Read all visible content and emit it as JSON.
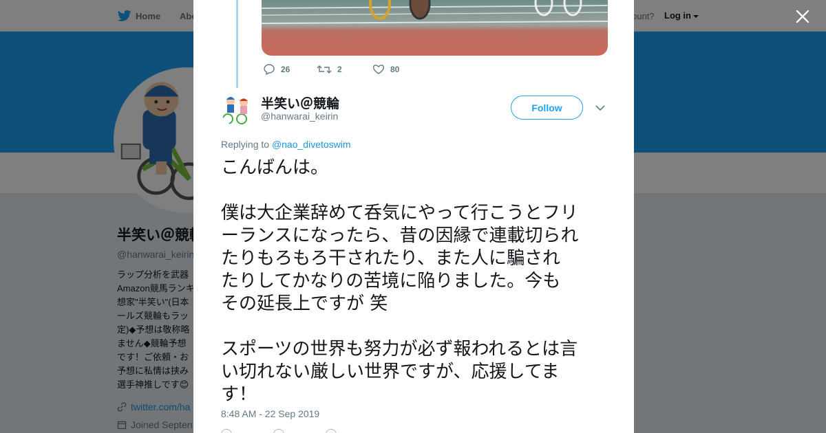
{
  "nav": {
    "home_label": "Home",
    "about_label": "Abo",
    "account_text": "ccount?",
    "login_label": "Log in"
  },
  "profile": {
    "name": "半笑い＠競輪",
    "handle": "@hanwarai_keirin",
    "bio": "ラップ分析を武器\nAmazon競馬ランキ\n想家\"半笑い\"(日本\nールズ競輪もラッ\n定)◆予想は敬称略\nません◆競輪予想\nです！ご依頼・お\n予想に私情は挟み\n選手神推しです😊",
    "link": "twitter.com/ha",
    "joined": "Joined Septen"
  },
  "quoted_tweet": {
    "replies": "26",
    "retweets": "2",
    "likes": "80"
  },
  "tweet": {
    "author_name": "半笑い＠競輪",
    "author_handle": "@hanwarai_keirin",
    "follow_label": "Follow",
    "replying_prefix": "Replying to",
    "replying_to": "@nao_divetoswim",
    "text_lines": [
      "こんばんは。",
      "",
      "僕は大企業辞めて呑気にやって行こうとフリ",
      "ーランスになったら、昔の因縁で連載切られ",
      "たりもろもろ干されたり、また人に騙され",
      "たりしてかなりの苦境に陥りました。今も",
      "その延長上ですが 笑",
      "",
      "スポーツの世界も努力が必ず報われるとは言",
      "い切れない厳しい世界ですが、応援してま",
      "す！"
    ],
    "timestamp": "8:48 AM - 22 Sep 2019"
  },
  "colors": {
    "brand_blue": "#1da1f2",
    "link_blue": "#1b95e0",
    "thread_line": "#a8d4f2",
    "muted_text": "#657786"
  }
}
